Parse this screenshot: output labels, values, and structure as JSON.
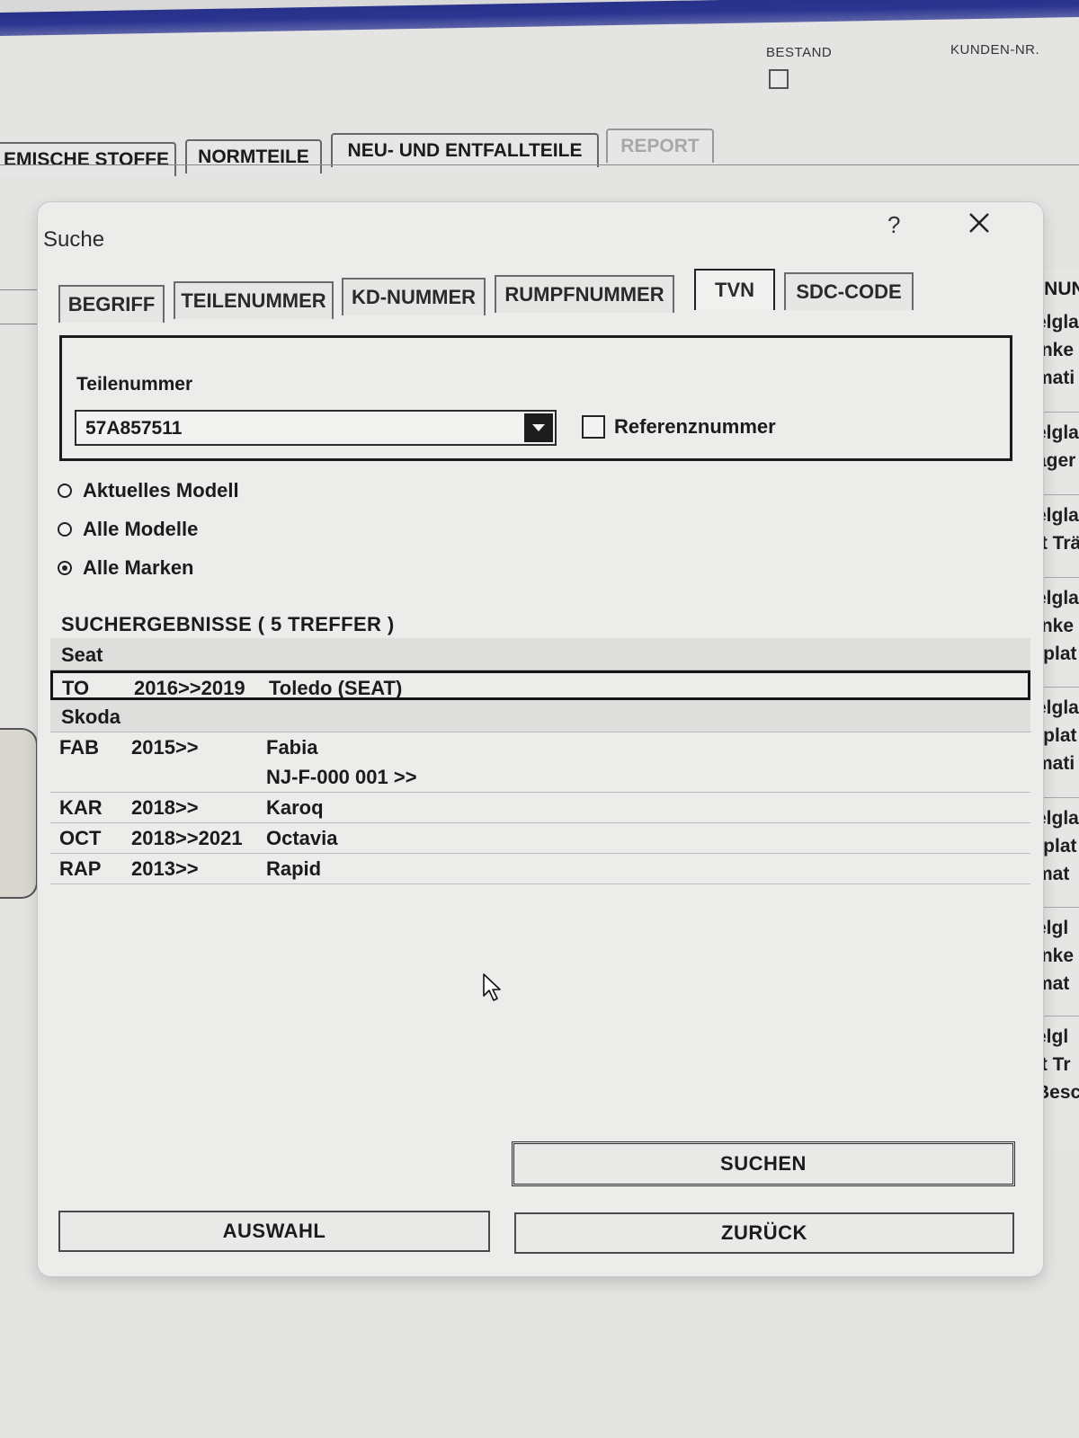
{
  "background": {
    "top_labels": {
      "bestand": "BESTAND",
      "kunden_nr": "KUNDEN-NR."
    },
    "tabs": [
      {
        "label": "EMISCHE STOFFE",
        "disabled": false
      },
      {
        "label": "NORMTEILE",
        "disabled": false
      },
      {
        "label": "NEU- UND ENTFALLTEILE",
        "disabled": false
      },
      {
        "label": "REPORT",
        "disabled": true
      }
    ],
    "side_header": "NNUN",
    "side_items": [
      [
        "elgla",
        "inke",
        "mati"
      ],
      [
        "elgla",
        "äger"
      ],
      [
        "elgla",
        "it Trä"
      ],
      [
        "elgla",
        "inke",
        "rplat"
      ],
      [
        "elgla",
        "rplat",
        "mati"
      ],
      [
        "elgla",
        "rplat",
        "mat"
      ],
      [
        "elgl",
        "inke",
        "mat"
      ],
      [
        "elgl",
        "it Tr",
        "Besc"
      ]
    ]
  },
  "dialog": {
    "title": "Suche",
    "help_label": "?",
    "tabs": [
      {
        "label": "BEGRIFF",
        "active": false
      },
      {
        "label": "TEILENUMMER",
        "active": false
      },
      {
        "label": "KD-NUMMER",
        "active": false
      },
      {
        "label": "RUMPFNUMMER",
        "active": false
      },
      {
        "label": "TVN",
        "active": true
      },
      {
        "label": "SDC-CODE",
        "active": false
      }
    ],
    "field_label": "Teilenummer",
    "field_value": "57A857511",
    "reference_checkbox_label": "Referenznummer",
    "reference_checked": false,
    "scope_options": [
      {
        "label": "Aktuelles Modell",
        "selected": false
      },
      {
        "label": "Alle Modelle",
        "selected": false
      },
      {
        "label": "Alle Marken",
        "selected": true
      }
    ],
    "results_title": "SUCHERGEBNISSE  ( 5 TREFFER )",
    "result_groups": [
      {
        "brand": "Seat",
        "rows": [
          {
            "code": "TO",
            "years": "2016>>2019",
            "model": "Toledo (SEAT)",
            "extra": "",
            "selected": true
          }
        ]
      },
      {
        "brand": "Skoda",
        "rows": [
          {
            "code": "FAB",
            "years": "2015>>",
            "model": "Fabia",
            "extra": "NJ-F-000 001 >>",
            "selected": false
          },
          {
            "code": "KAR",
            "years": "2018>>",
            "model": "Karoq",
            "extra": "",
            "selected": false
          },
          {
            "code": "OCT",
            "years": "2018>>2021",
            "model": "Octavia",
            "extra": "",
            "selected": false
          },
          {
            "code": "RAP",
            "years": "2013>>",
            "model": "Rapid",
            "extra": "",
            "selected": false
          }
        ]
      }
    ],
    "buttons": {
      "search": "SUCHEN",
      "select": "AUSWAHL",
      "back": "ZURÜCK"
    }
  }
}
